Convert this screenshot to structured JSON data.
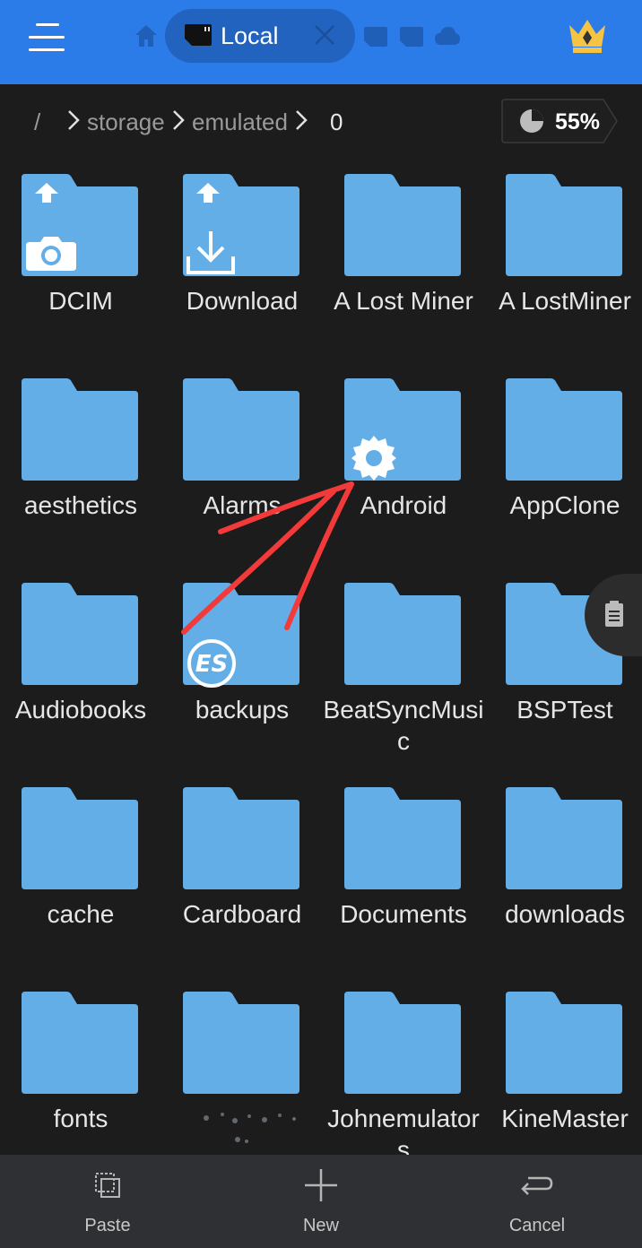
{
  "topbar": {
    "menu_icon": "hamburger-menu-icon",
    "tabs": [
      {
        "icon": "home-icon"
      },
      {
        "icon": "sd-card-icon",
        "label": "Local",
        "close_icon": "close-icon"
      },
      {
        "icon": "sd-card-icon"
      },
      {
        "icon": "sd-card-icon"
      },
      {
        "icon": "cloud-icon"
      }
    ],
    "premium_icon": "crown-icon"
  },
  "breadcrumb": {
    "root": "/",
    "parts": [
      "storage",
      "emulated",
      "0"
    ]
  },
  "storage": {
    "percent_label": "55%",
    "percent_used": 55
  },
  "folders": [
    {
      "name": "DCIM",
      "badge": "camera"
    },
    {
      "name": "Download",
      "badge": "download"
    },
    {
      "name": "A Lost Miner"
    },
    {
      "name": "A LostMiner"
    },
    {
      "name": "aesthetics"
    },
    {
      "name": "Alarms"
    },
    {
      "name": "Android",
      "badge": "gear"
    },
    {
      "name": "AppClone"
    },
    {
      "name": "Audiobooks"
    },
    {
      "name": "backups",
      "badge": "es"
    },
    {
      "name": "BeatSyncMusic"
    },
    {
      "name": "BSPTest"
    },
    {
      "name": "cache"
    },
    {
      "name": "Cardboard"
    },
    {
      "name": "Documents"
    },
    {
      "name": "downloads"
    },
    {
      "name": "fonts"
    },
    {
      "name": ""
    },
    {
      "name": "Johnemulators"
    },
    {
      "name": "KineMaster"
    }
  ],
  "bottombar": {
    "paste": "Paste",
    "new": "New",
    "cancel": "Cancel"
  },
  "colors": {
    "topbar": "#2b7ce9",
    "folder": "#64aee8",
    "background": "#1c1c1c",
    "annotation": "#f23a3a"
  }
}
